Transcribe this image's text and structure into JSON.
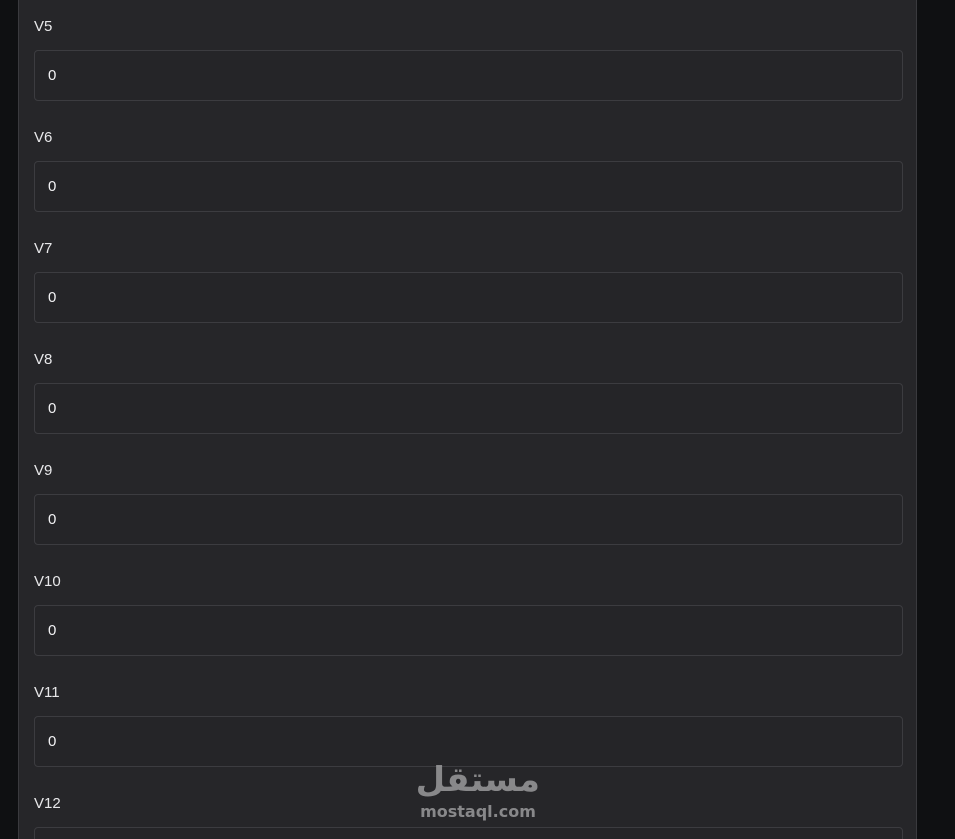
{
  "fields": [
    {
      "label": "V5",
      "value": "0"
    },
    {
      "label": "V6",
      "value": "0"
    },
    {
      "label": "V7",
      "value": "0"
    },
    {
      "label": "V8",
      "value": "0"
    },
    {
      "label": "V9",
      "value": "0"
    },
    {
      "label": "V10",
      "value": "0"
    },
    {
      "label": "V11",
      "value": "0"
    },
    {
      "label": "V12",
      "value": ""
    }
  ],
  "watermark": {
    "arabic": "مستقل",
    "latin": "mostaql.com"
  }
}
